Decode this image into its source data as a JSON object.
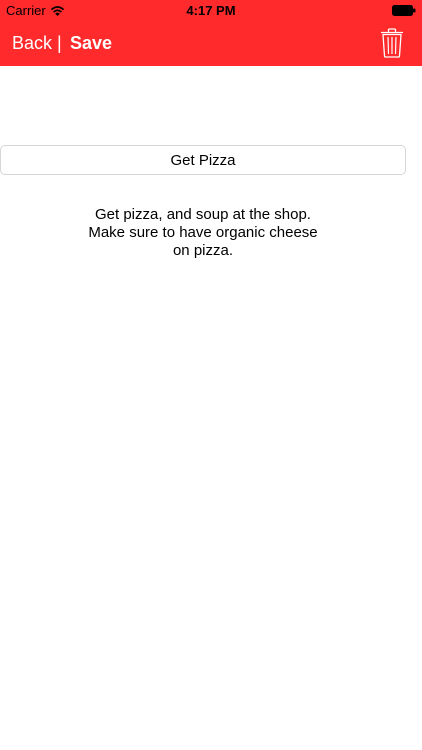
{
  "status_bar": {
    "carrier": "Carrier",
    "time": "4:17 PM",
    "wifi_icon": "wifi-icon",
    "battery_icon": "battery-icon"
  },
  "nav": {
    "back_label": "Back",
    "separator": "|",
    "save_label": "Save",
    "delete_icon": "trash-icon",
    "bar_color": "#fe2a2c"
  },
  "note": {
    "title": "Get Pizza",
    "body": "Get pizza, and soup at the shop.\nMake sure to have organic cheese\non pizza."
  }
}
